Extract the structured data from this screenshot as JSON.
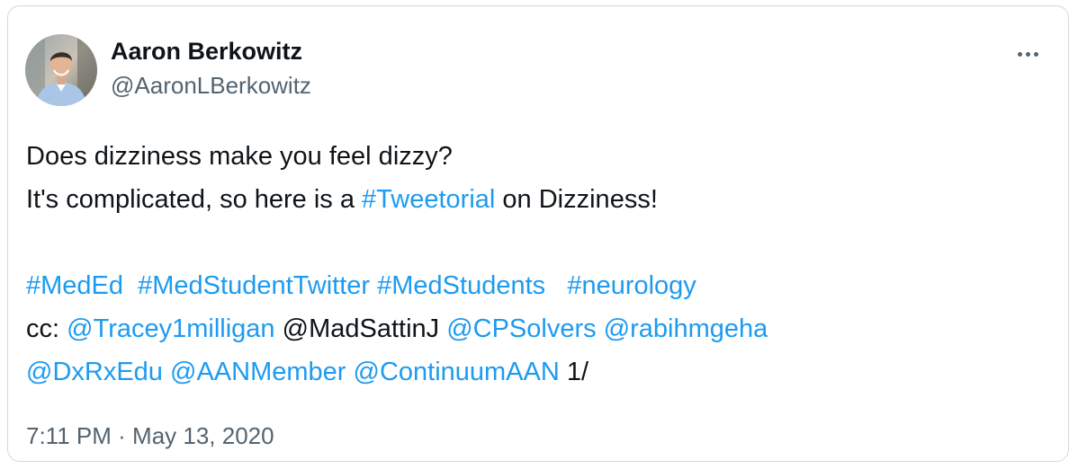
{
  "author": {
    "name": "Aaron Berkowitz",
    "handle": "@AaronLBerkowitz"
  },
  "menu": {
    "icon": "more-horizontal-icon"
  },
  "tweet": {
    "line1": "Does dizziness make you feel dizzy?",
    "line2_prefix": "It's complicated, so here is a ",
    "line2_hashtag": "#Tweetorial",
    "line2_suffix": " on Dizziness!",
    "hashtags": [
      "#MedEd",
      "#MedStudentTwitter",
      "#MedStudents",
      "#neurology"
    ],
    "cc_prefix": "cc: ",
    "mention1": "@Tracey1milligan",
    "plain_mention": "@MadSattinJ",
    "mention2": "@CPSolvers",
    "mention3": "@rabihmgeha",
    "mention4": "@DxRxEdu",
    "mention5": "@AANMember",
    "mention6": "@ContinuumAAN",
    "thread_marker": "1/"
  },
  "timestamp": {
    "time": "7:11 PM",
    "separator": "·",
    "date": "May 13, 2020"
  },
  "colors": {
    "link": "#1d9bf0",
    "text": "#0f1419",
    "secondary": "#536471",
    "border": "#cfd9de"
  }
}
